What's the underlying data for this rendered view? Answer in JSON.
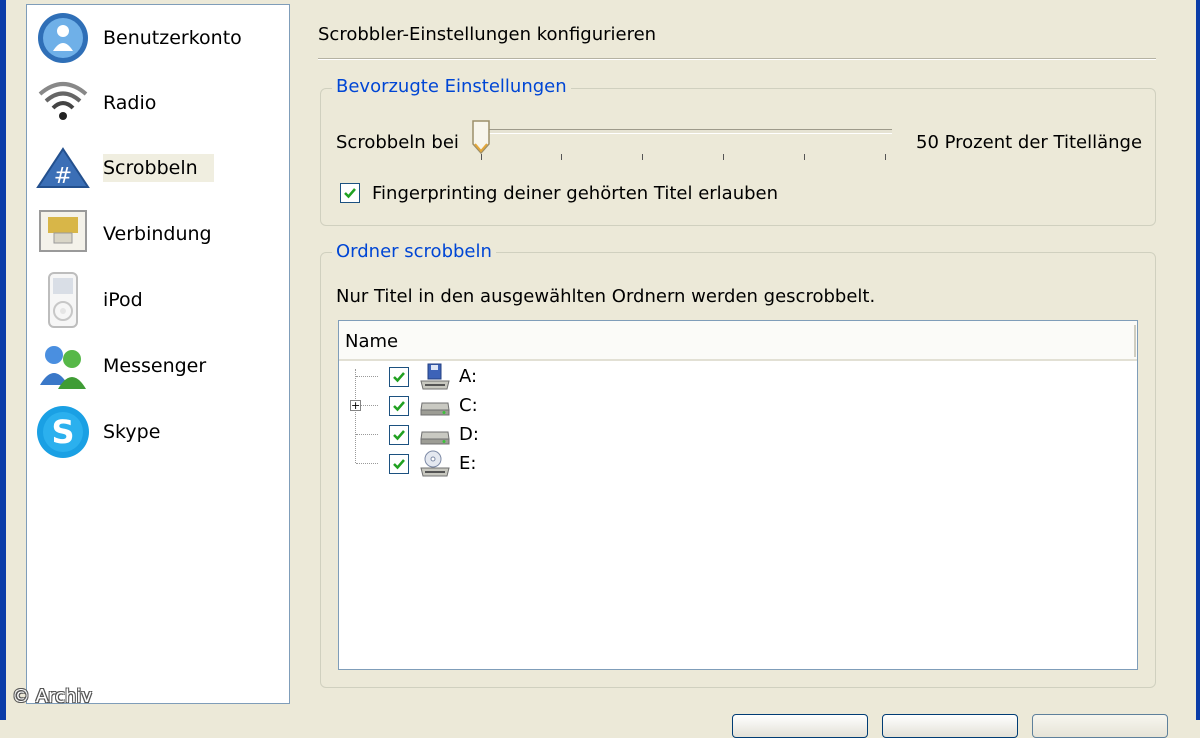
{
  "sidebar": {
    "items": [
      {
        "label": "Benutzerkonto",
        "icon": "user-account-icon"
      },
      {
        "label": "Radio",
        "icon": "radio-wifi-icon"
      },
      {
        "label": "Scrobbeln",
        "icon": "scrobble-icon",
        "selected": true
      },
      {
        "label": "Verbindung",
        "icon": "network-connection-icon"
      },
      {
        "label": "iPod",
        "icon": "ipod-icon"
      },
      {
        "label": "Messenger",
        "icon": "messenger-icon"
      },
      {
        "label": "Skype",
        "icon": "skype-icon"
      }
    ]
  },
  "main": {
    "title": "Scrobbler-Einstellungen konfigurieren",
    "preferences": {
      "legend": "Bevorzugte Einstellungen",
      "slider_label": "Scrobbeln bei",
      "slider_value_text": "50 Prozent der Titellänge",
      "slider_value_fraction": 0.0,
      "fingerprint_label": "Fingerprinting deiner gehörten Titel erlauben",
      "fingerprint_checked": true
    },
    "folders": {
      "legend": "Ordner scrobbeln",
      "description": "Nur Titel in den ausgewählten Ordnern werden gescrobbelt.",
      "column_header": "Name",
      "drives": [
        {
          "label": "A:",
          "icon": "floppy-drive-icon",
          "checked": true,
          "expandable": false
        },
        {
          "label": "C:",
          "icon": "hard-drive-icon",
          "checked": true,
          "expandable": true
        },
        {
          "label": "D:",
          "icon": "hard-drive-icon",
          "checked": true,
          "expandable": false
        },
        {
          "label": "E:",
          "icon": "cd-drive-icon",
          "checked": true,
          "expandable": false
        }
      ]
    }
  },
  "watermark": "© Archiv",
  "colors": {
    "window_frame": "#0a3ca8",
    "dialog_bg": "#ece9d8",
    "group_legend": "#0046d5",
    "check_mark": "#21a121"
  }
}
